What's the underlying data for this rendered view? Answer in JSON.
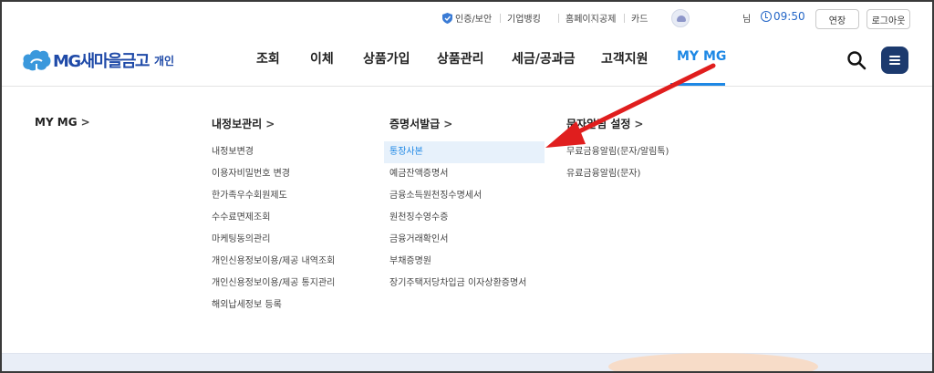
{
  "utility": {
    "auth": "인증/보안",
    "corporate": "기업뱅킹",
    "homepage": "홈페이지",
    "mutual": "공제",
    "card": "카드",
    "user_suffix": "님",
    "timer": "09:50",
    "extend": "연장",
    "logout": "로그아웃"
  },
  "header": {
    "brand": "MG새마을금고",
    "sub": "개인"
  },
  "nav": {
    "tabs": [
      "조회",
      "이체",
      "상품가입",
      "상품관리",
      "세금/공과금",
      "고객지원",
      "MY MG"
    ],
    "active_index": 6
  },
  "menu": {
    "col1": {
      "title": "MY MG"
    },
    "col2": {
      "title": "내정보관리",
      "items": [
        "내정보변경",
        "이용자비밀번호 변경",
        "한가족우수회원제도",
        "수수료면제조회",
        "마케팅동의관리",
        "개인신용정보이용/제공 내역조회",
        "개인신용정보이용/제공 통지관리",
        "해외납세정보 등록"
      ]
    },
    "col3": {
      "title": "증명서발급",
      "items": [
        "통장사본",
        "예금잔액증명서",
        "금융소득원천징수명세서",
        "원천징수영수증",
        "금융거래확인서",
        "부채증명원",
        "장기주택저당차입금 이자상환증명서"
      ],
      "active_index": 0
    },
    "col4": {
      "title": "문자알림 설정",
      "items": [
        "무료금융알림(문자/알림톡)",
        "유료금융알림(문자)"
      ]
    },
    "chevron": ">"
  },
  "colors": {
    "brand": "#1f4aa8",
    "accent": "#1e88e5",
    "arrow": "#e01e1e",
    "menu_button": "#1c3a6e"
  },
  "icons": {
    "auth": "shield-check-icon",
    "avatar": "character-avatar-icon",
    "timer": "clock-icon",
    "search": "search-icon",
    "menu": "hamburger-menu-icon",
    "annotation": "red-arrow-icon"
  }
}
